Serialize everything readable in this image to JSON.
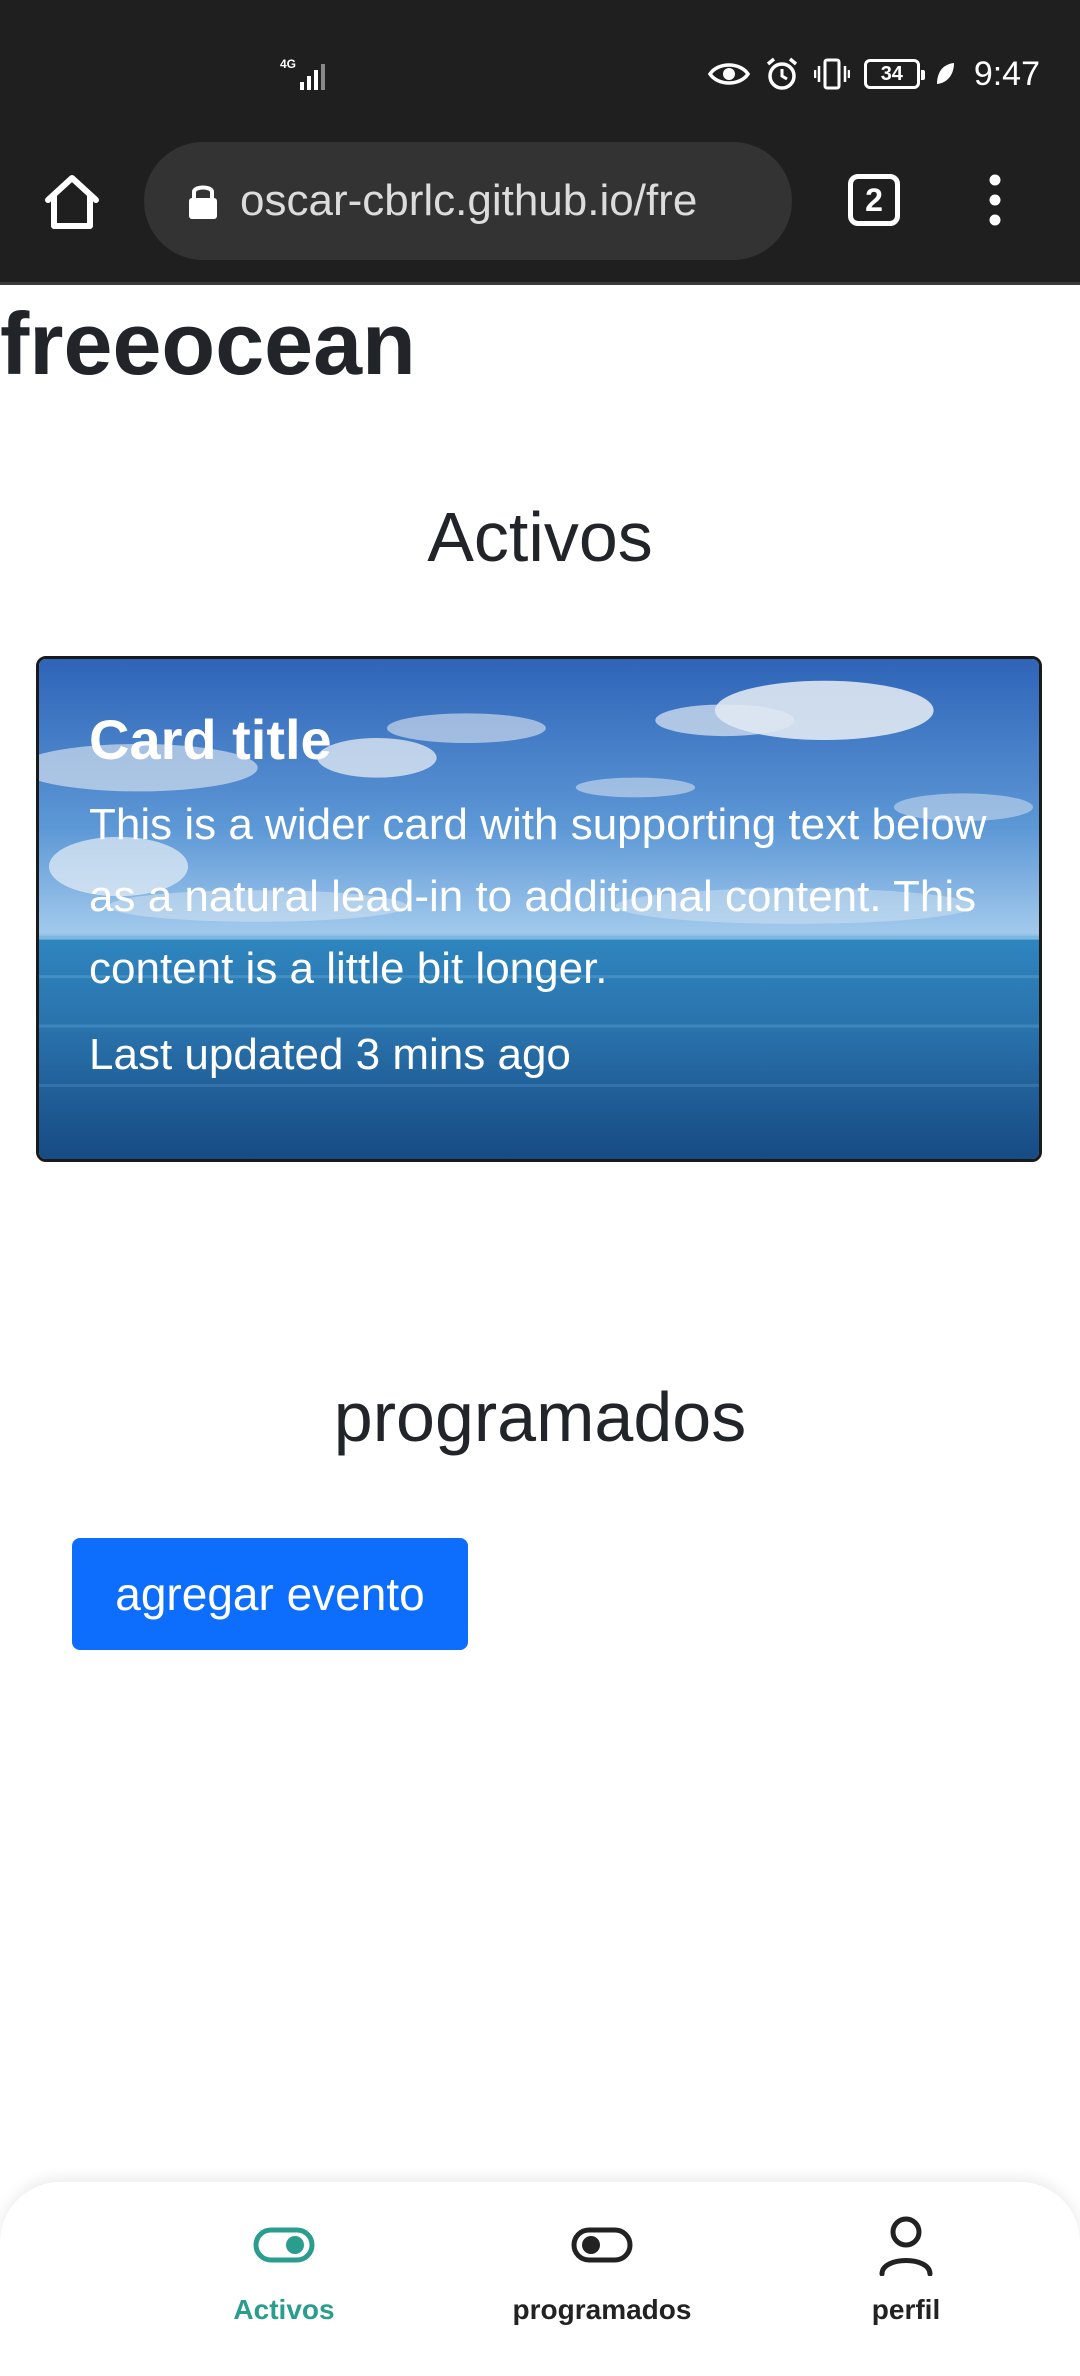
{
  "status_bar": {
    "network": "4G",
    "battery": "34",
    "time": "9:47"
  },
  "browser": {
    "url": "oscar-cbrlc.github.io/fre",
    "tab_count": "2"
  },
  "page": {
    "brand": "freeocean",
    "section_activos": "Activos",
    "card": {
      "title": "Card title",
      "text": "This is a wider card with supporting text below as a natural lead-in to additional content. This content is a little bit longer.",
      "updated": "Last updated 3 mins ago"
    },
    "section_programados": "programados",
    "add_button": "agregar evento"
  },
  "bottom_nav": {
    "items": [
      {
        "label": "Activos",
        "icon": "toggle-on-icon",
        "active": true
      },
      {
        "label": "programados",
        "icon": "toggle-off-icon",
        "active": false
      },
      {
        "label": "perfil",
        "icon": "person-icon",
        "active": false
      }
    ]
  },
  "colors": {
    "primary_button": "#0d6efd",
    "nav_active": "#2a9d8f",
    "browser_chrome": "#1f1f1f"
  }
}
